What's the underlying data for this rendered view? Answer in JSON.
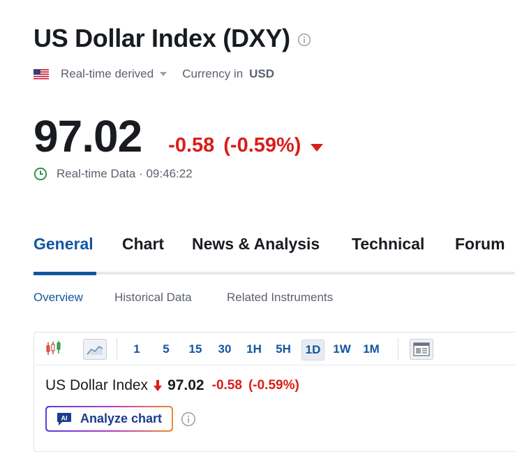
{
  "header": {
    "title": "US Dollar Index (DXY)",
    "source": "Real-time derived",
    "currency_label": "Currency in",
    "currency": "USD"
  },
  "quote": {
    "price": "97.02",
    "change": "-0.58",
    "change_pct": "(-0.59%)",
    "data_label": "Real-time Data · 09:46:22"
  },
  "tabs": [
    {
      "label": "General",
      "active": true
    },
    {
      "label": "Chart",
      "active": false
    },
    {
      "label": "News & Analysis",
      "active": false
    },
    {
      "label": "Technical",
      "active": false
    },
    {
      "label": "Forum",
      "active": false
    }
  ],
  "subtabs": [
    {
      "label": "Overview",
      "active": true
    },
    {
      "label": "Historical Data",
      "active": false
    },
    {
      "label": "Related Instruments",
      "active": false
    }
  ],
  "chart_toolbar": {
    "timeframes": [
      "1",
      "5",
      "15",
      "30",
      "1H",
      "5H",
      "1D",
      "1W",
      "1M"
    ],
    "active_timeframe": "1D"
  },
  "chart_quote": {
    "name": "US Dollar Index",
    "price": "97.02",
    "change": "-0.58",
    "change_pct": "(-0.59%)"
  },
  "analyze_button": {
    "label": "Analyze chart",
    "badge": "AI"
  },
  "colors": {
    "accent": "#1256a0",
    "negative": "#d91e18",
    "text": "#181c21",
    "muted": "#5b616e",
    "positive_icon": "#1e8a3c"
  }
}
